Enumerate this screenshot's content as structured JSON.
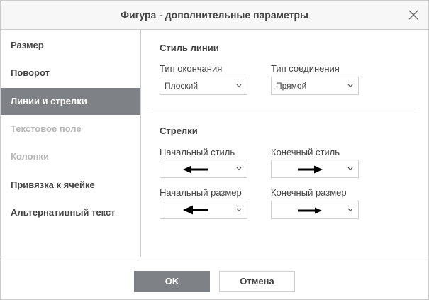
{
  "dialog": {
    "title": "Фигура - дополнительные параметры"
  },
  "sidebar": {
    "items": [
      {
        "label": "Размер",
        "state": "normal"
      },
      {
        "label": "Поворот",
        "state": "normal"
      },
      {
        "label": "Линии и стрелки",
        "state": "active"
      },
      {
        "label": "Текстовое поле",
        "state": "disabled"
      },
      {
        "label": "Колонки",
        "state": "disabled"
      },
      {
        "label": "Привязка к ячейке",
        "state": "normal"
      },
      {
        "label": "Альтернативный текст",
        "state": "normal"
      }
    ]
  },
  "line_style": {
    "section_title": "Стиль линии",
    "cap_type": {
      "label": "Тип окончания",
      "value": "Плоский"
    },
    "join_type": {
      "label": "Тип соединения",
      "value": "Прямой"
    }
  },
  "arrows": {
    "section_title": "Стрелки",
    "begin_style": {
      "label": "Начальный стиль",
      "icon": "arrow-left-icon"
    },
    "end_style": {
      "label": "Конечный стиль",
      "icon": "arrow-right-icon"
    },
    "begin_size": {
      "label": "Начальный размер",
      "icon": "arrow-left-icon"
    },
    "end_size": {
      "label": "Конечный размер",
      "icon": "arrow-right-icon"
    }
  },
  "footer": {
    "ok_label": "OK",
    "cancel_label": "Отмена"
  },
  "colors": {
    "accent": "#7e8287",
    "border": "#cbcbcb",
    "disabled_text": "#b7b7b7"
  }
}
